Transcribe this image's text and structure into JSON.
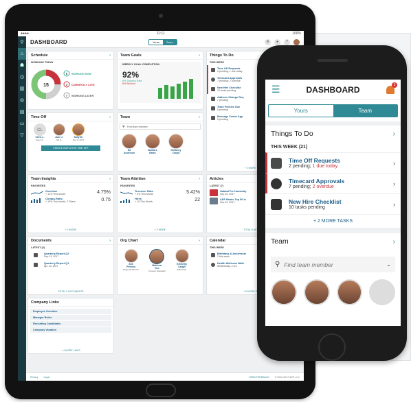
{
  "tablet": {
    "status_time": "11:11",
    "status_right": "100%",
    "title": "DASHBOARD",
    "tabs": [
      "Yours",
      "Team"
    ],
    "schedule": {
      "title": "Schedule",
      "sub": "WORKING TODAY",
      "center": "15",
      "items": [
        {
          "n": "5",
          "label": "WORKING NOW"
        },
        {
          "n": "3",
          "label": "CURRENTLY LATE"
        },
        {
          "n": "7",
          "label": "WORKING LATER"
        }
      ]
    },
    "goals": {
      "title": "Team Goals",
      "sub": "WEEKLY GOAL COMPLETION",
      "value": "92%",
      "line1": "6% Success Rate",
      "line2": "8% Blocked"
    },
    "things": {
      "title": "Things To Do",
      "sub": "THIS WEEK",
      "items": [
        {
          "t": "Time Off Requests",
          "s": "2 pending; 1 due today"
        },
        {
          "t": "Timecard Approvals",
          "s": "7 pending; 2 overdue"
        },
        {
          "t": "New Hire Checklist",
          "s": "10 tasks pending"
        },
        {
          "t": "Address Change Req",
          "s": "7 pending"
        },
        {
          "t": "Team Policies Due",
          "s": "5 pending"
        },
        {
          "t": "Message Center App",
          "s": "5 pending"
        }
      ],
      "more": "+ 2 MORE TASKS"
    },
    "timeoff": {
      "title": "Time Off",
      "people": [
        {
          "n": "Chris L.",
          "d": "Sep 21–"
        },
        {
          "n": "Jane J.",
          "d": "Oct 5–"
        },
        {
          "n": "Sally M.",
          "d": "Nov 5, 2017"
        }
      ],
      "button": "CREATE EMPLOYEE TIME OFF"
    },
    "team": {
      "title": "Team",
      "search": "Find team member",
      "people": [
        {
          "n": "Ed",
          "s": "Anderson"
        },
        {
          "n": "Barbara",
          "s": "Bates"
        },
        {
          "n": "Kimberly",
          "s": "Cargill"
        }
      ]
    },
    "insights": {
      "title": "Team Insights",
      "sub": "FAVORITES",
      "items": [
        {
          "t": "Overtime",
          "s": "+ 12% This Month",
          "v": "4.75%"
        },
        {
          "t": "Compa-Ratio",
          "s": "+ 15% This Month, 2 Filters",
          "v": "0.75"
        }
      ],
      "more": "+ 2 MORE"
    },
    "attrition": {
      "title": "Team Attrition",
      "sub": "FAVORITES",
      "items": [
        {
          "t": "Turnover Rate",
          "s": "+ 2% This Month",
          "v": "5.42%"
        },
        {
          "t": "Hires",
          "s": "+ 15 This Month",
          "v": "22"
        }
      ],
      "more": "+ 2 MORE"
    },
    "articles": {
      "title": "Articles",
      "sub": "LATEST (7)",
      "items": [
        {
          "t": "Habitat For Humanity",
          "s": "Sep 15, 2017"
        },
        {
          "t": "ADP Ranks Top 50 in",
          "s": "Sep 12, 2017"
        }
      ],
      "more": "TOTAL 8 ARTICLES"
    },
    "documents": {
      "title": "Documents",
      "sub": "LATEST (2)",
      "items": [
        {
          "t": "Quarterly Report Q2",
          "s": "Sep 13, 2017"
        },
        {
          "t": "Quarterly Report Q1",
          "s": "Apr 10, 2017"
        }
      ],
      "more": "TOTAL 9 DOCUMENTS"
    },
    "org": {
      "title": "Org Chart",
      "people": [
        {
          "n": "Ann",
          "s": "Petrova",
          "r": "Regional Director"
        },
        {
          "n": "Matthew",
          "s": "Vice",
          "r": "Finance Specialist"
        },
        {
          "n": "Kimberly",
          "s": "Cargill",
          "r": "Sales Rep."
        }
      ]
    },
    "calendar": {
      "title": "Calendar",
      "sub": "THIS WEEK",
      "items": [
        {
          "t": "Birthdays & Anniversar",
          "s": "2 this week"
        },
        {
          "t": "Health Wellness Walk",
          "s": "Wednesday, 2 pm"
        }
      ],
      "more": "+ 5 MORE EVENTS"
    },
    "links": {
      "title": "Company Links",
      "items": [
        "Employee Overtime",
        "Manager Retire",
        "Recruiting Candidates",
        "Company Vacation"
      ],
      "more": "+ 4 MORE LINKS"
    },
    "footer": {
      "privacy": "Privacy",
      "legal": "Legal",
      "feedback": "SEND FEEDBACK",
      "copyright": "© 2016-2017 ADP, LLC"
    }
  },
  "phone": {
    "title": "DASHBOARD",
    "badge": "3",
    "tabs": [
      "Yours",
      "Team"
    ],
    "things_title": "Things To Do",
    "week": "THIS WEEK (21)",
    "items": [
      {
        "t": "Time Off Requests",
        "s1": "2 pending; ",
        "s2": "1 due today"
      },
      {
        "t": "Timecard Approvals",
        "s1": "7 pending; ",
        "s2": "2 overdue"
      },
      {
        "t": "New Hire Checklist",
        "s1": "10 tasks pending",
        "s2": ""
      }
    ],
    "more": "+ 2 MORE TASKS",
    "team_title": "Team",
    "search_placeholder": "Find team member"
  }
}
